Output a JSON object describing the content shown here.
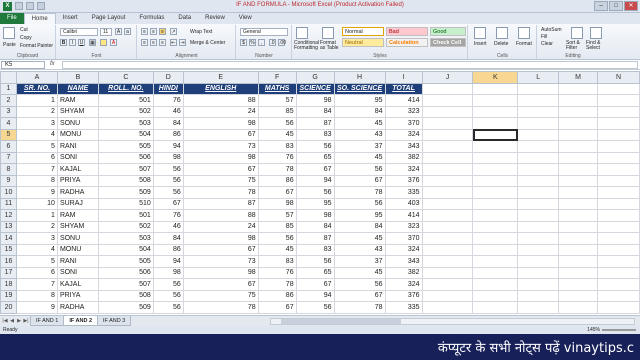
{
  "window": {
    "title": "IF AND FORMULA - Microsoft Excel (Product Activation Failed)",
    "logo": "X"
  },
  "ribbon": {
    "file_tab": "File",
    "tabs": [
      "Home",
      "Insert",
      "Page Layout",
      "Formulas",
      "Data",
      "Review",
      "View"
    ],
    "clipboard": {
      "cut": "Cut",
      "copy": "Copy",
      "format_painter": "Format Painter",
      "paste": "Paste",
      "label": "Clipboard"
    },
    "font": {
      "name": "Calibri",
      "size": "11",
      "label": "Font"
    },
    "alignment": {
      "wrap": "Wrap Text",
      "merge": "Merge & Center",
      "label": "Alignment"
    },
    "number": {
      "format": "General",
      "label": "Number"
    },
    "styles": {
      "cond": "Conditional Formatting",
      "table": "Format as Table",
      "normal": "Normal",
      "bad": "Bad",
      "good": "Good",
      "neutral": "Neutral",
      "calculation": "Calculation",
      "check": "Check Cell",
      "label": "Styles"
    },
    "cells": {
      "insert": "Insert",
      "delete": "Delete",
      "format": "Format",
      "label": "Cells"
    },
    "editing": {
      "autosum": "AutoSum",
      "fill": "Fill",
      "clear": "Clear",
      "sort": "Sort & Filter",
      "find": "Find & Select",
      "label": "Editing"
    }
  },
  "formula_bar": {
    "name_box": "K5",
    "fx": "fx",
    "value": ""
  },
  "grid": {
    "columns": [
      "A",
      "B",
      "C",
      "D",
      "E",
      "F",
      "G",
      "H",
      "I",
      "J",
      "K",
      "L",
      "M",
      "N"
    ],
    "selected_col": "K",
    "selected_row": 5,
    "headers": [
      "SR. NO.",
      "NAME",
      "ROLL. NO.",
      "HINDI",
      "ENGLISH",
      "MATHS",
      "SCIENCE",
      "SO. SCIENCE",
      "TOTAL"
    ],
    "rows": [
      [
        1,
        "RAM",
        501,
        76,
        88,
        57,
        98,
        95,
        414
      ],
      [
        2,
        "SHYAM",
        502,
        46,
        24,
        85,
        84,
        84,
        323
      ],
      [
        3,
        "SONU",
        503,
        84,
        98,
        56,
        87,
        45,
        370
      ],
      [
        4,
        "MONU",
        504,
        86,
        67,
        45,
        83,
        43,
        324
      ],
      [
        5,
        "RANI",
        505,
        94,
        73,
        83,
        56,
        37,
        343
      ],
      [
        6,
        "SONI",
        506,
        98,
        98,
        76,
        65,
        45,
        382
      ],
      [
        7,
        "KAJAL",
        507,
        56,
        67,
        78,
        67,
        56,
        324
      ],
      [
        8,
        "PRIYA",
        508,
        56,
        75,
        86,
        94,
        67,
        376
      ],
      [
        9,
        "RADHA",
        509,
        56,
        78,
        67,
        56,
        78,
        335
      ],
      [
        10,
        "SURAJ",
        510,
        67,
        87,
        98,
        95,
        56,
        403
      ],
      [
        1,
        "RAM",
        501,
        76,
        88,
        57,
        98,
        95,
        414
      ],
      [
        2,
        "SHYAM",
        502,
        46,
        24,
        85,
        84,
        84,
        323
      ],
      [
        3,
        "SONU",
        503,
        84,
        98,
        56,
        87,
        45,
        370
      ],
      [
        4,
        "MONU",
        504,
        86,
        67,
        45,
        83,
        43,
        324
      ],
      [
        5,
        "RANI",
        505,
        94,
        73,
        83,
        56,
        37,
        343
      ],
      [
        6,
        "SONI",
        506,
        98,
        98,
        76,
        65,
        45,
        382
      ],
      [
        7,
        "KAJAL",
        507,
        56,
        67,
        78,
        67,
        56,
        324
      ],
      [
        8,
        "PRIYA",
        508,
        56,
        75,
        86,
        94,
        67,
        376
      ],
      [
        9,
        "RADHA",
        509,
        56,
        78,
        67,
        56,
        78,
        335
      ]
    ]
  },
  "sheets": {
    "tabs": [
      "IF AND 1",
      "IF AND 2",
      "IF AND 3"
    ],
    "active": "IF AND 2"
  },
  "status": {
    "ready": "Ready",
    "zoom": "145%"
  },
  "banner": {
    "text": "कंप्यूटर के सभी नोट्स पढ़ें vinaytips.c"
  }
}
